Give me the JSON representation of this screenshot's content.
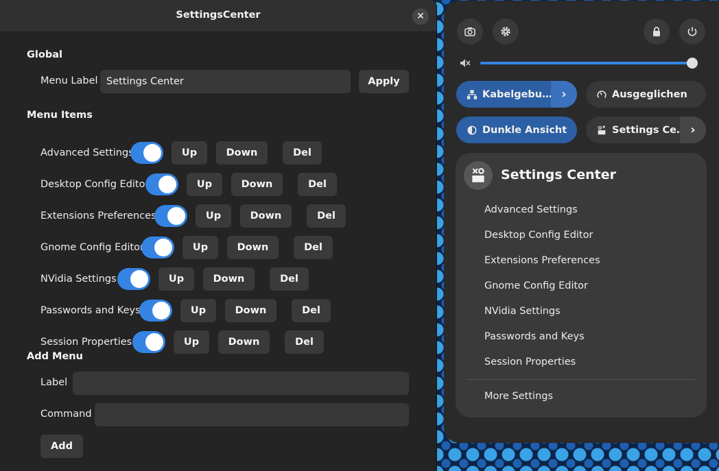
{
  "window": {
    "title": "SettingsCenter",
    "close_glyph": "✕"
  },
  "global": {
    "section_title": "Global",
    "menu_label_label": "Menu Label",
    "menu_label_value": "Settings Center",
    "apply_label": "Apply"
  },
  "menu_items": {
    "section_title": "Menu Items",
    "up_label": "Up",
    "down_label": "Down",
    "del_label": "Del",
    "items": [
      {
        "label": "Advanced Settings",
        "enabled": true
      },
      {
        "label": "Desktop Config Editor",
        "enabled": true
      },
      {
        "label": "Extensions Preferences",
        "enabled": true
      },
      {
        "label": "Gnome Config Editor",
        "enabled": true
      },
      {
        "label": "NVidia Settings",
        "enabled": true
      },
      {
        "label": "Passwords and Keys",
        "enabled": true
      },
      {
        "label": "Session Properties",
        "enabled": true
      }
    ]
  },
  "add_menu": {
    "section_title": "Add Menu",
    "label_label": "Label",
    "label_value": "",
    "command_label": "Command",
    "command_value": "",
    "add_label": "Add"
  },
  "quick_settings": {
    "icons": [
      "camera-icon",
      "gear-icon",
      "lock-icon",
      "power-icon"
    ],
    "volume_icon": "speaker-muted-icon",
    "volume_level": 1.0,
    "tiles": [
      {
        "label": "Kabelgebu…",
        "icon": "network-wired-icon",
        "active": true,
        "has_arrow": true
      },
      {
        "label": "Ausgeglichen",
        "icon": "power-profile-icon",
        "active": false,
        "has_arrow": false
      },
      {
        "label": "Dunkle Ansicht",
        "icon": "dark-mode-icon",
        "active": true,
        "has_arrow": false
      },
      {
        "label": "Settings Ce…",
        "icon": "settings-center-icon",
        "active": false,
        "has_arrow": true
      }
    ],
    "menu": {
      "title": "Settings Center",
      "items": [
        "Advanced Settings",
        "Desktop Config Editor",
        "Extensions Preferences",
        "Gnome Config Editor",
        "NVidia Settings",
        "Passwords and Keys",
        "Session Properties"
      ],
      "footer_item": "More Settings"
    }
  },
  "colors": {
    "accent": "#3584e4",
    "window_bg": "#242424",
    "panel_bg": "#2a2a2a"
  }
}
